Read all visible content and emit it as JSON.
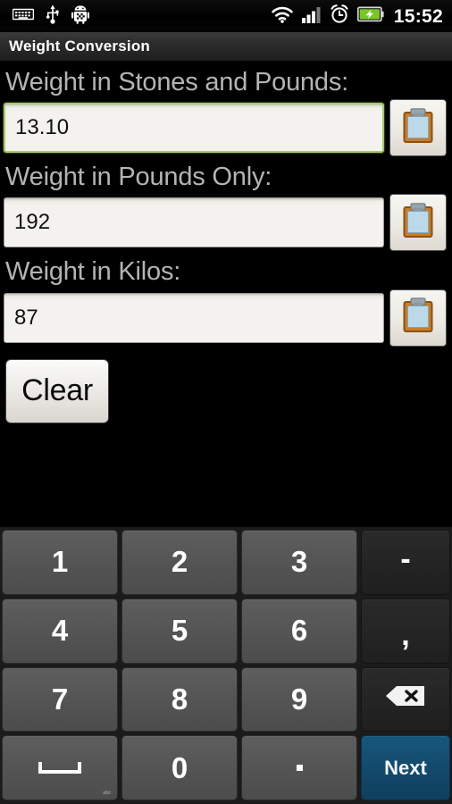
{
  "status_bar": {
    "icons_left": [
      "keyboard-icon",
      "usb-icon",
      "android-debug-icon"
    ],
    "icons_right": [
      "wifi-icon",
      "signal-icon",
      "alarm-icon",
      "battery-charging-icon"
    ],
    "time": "15:52"
  },
  "app": {
    "title": "Weight Conversion"
  },
  "fields": [
    {
      "label": "Weight in Stones and Pounds:",
      "value": "13.10",
      "focused": true,
      "copy_icon": "clipboard-icon"
    },
    {
      "label": "Weight in Pounds Only:",
      "value": "192",
      "focused": false,
      "copy_icon": "clipboard-icon"
    },
    {
      "label": "Weight in Kilos:",
      "value": "87",
      "focused": false,
      "copy_icon": "clipboard-icon"
    }
  ],
  "actions": {
    "clear_label": "Clear"
  },
  "keyboard": {
    "rows": [
      [
        {
          "label": "1",
          "name": "key-1",
          "style": "num"
        },
        {
          "label": "2",
          "name": "key-2",
          "style": "num"
        },
        {
          "label": "3",
          "name": "key-3",
          "style": "num"
        },
        {
          "label": "-",
          "name": "key-minus",
          "style": "punct"
        }
      ],
      [
        {
          "label": "4",
          "name": "key-4",
          "style": "num"
        },
        {
          "label": "5",
          "name": "key-5",
          "style": "num"
        },
        {
          "label": "6",
          "name": "key-6",
          "style": "num"
        },
        {
          "label": ",",
          "name": "key-comma",
          "style": "comma"
        }
      ],
      [
        {
          "label": "7",
          "name": "key-7",
          "style": "num"
        },
        {
          "label": "8",
          "name": "key-8",
          "style": "num"
        },
        {
          "label": "9",
          "name": "key-9",
          "style": "num"
        },
        {
          "label": "",
          "name": "key-backspace",
          "style": "backspace"
        }
      ],
      [
        {
          "label": "",
          "name": "key-space",
          "style": "space"
        },
        {
          "label": "0",
          "name": "key-0",
          "style": "num"
        },
        {
          "label": ".",
          "name": "key-period",
          "style": "dot"
        },
        {
          "label": "Next",
          "name": "key-next",
          "style": "accent"
        }
      ]
    ]
  },
  "colors": {
    "accent_key": "#12496b",
    "focus_border": "#a5c96f",
    "key_face": "#545454",
    "key_dark": "#242424",
    "field_bg": "#f4f2ee",
    "label_text": "#b4b4b4"
  }
}
